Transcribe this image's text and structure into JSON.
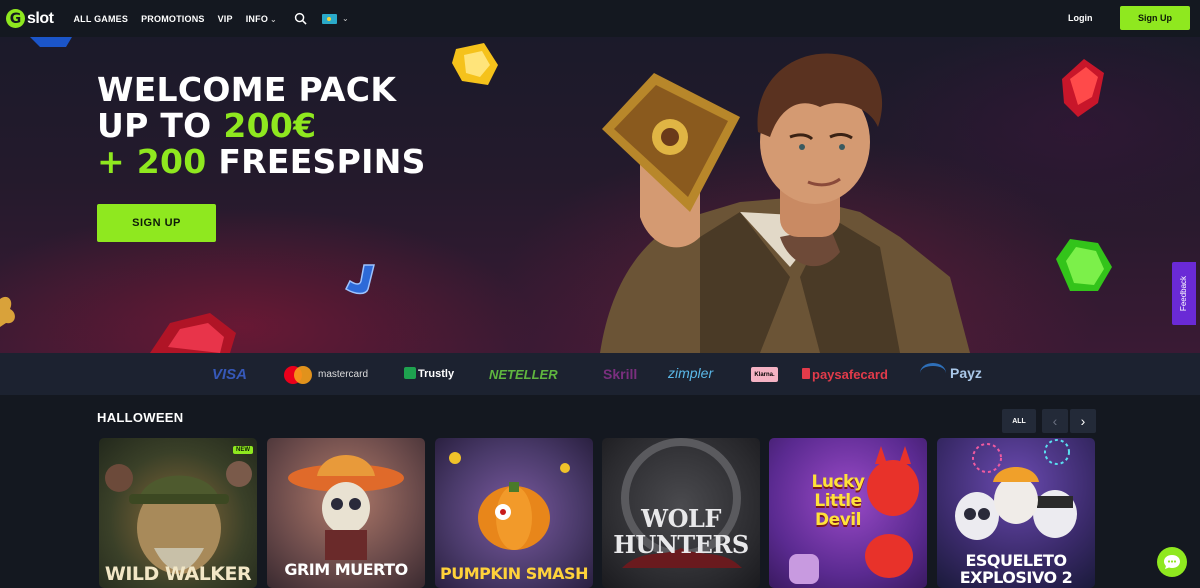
{
  "header": {
    "logo_letter": "G",
    "logo_text": "slot",
    "nav": [
      {
        "label": "ALL GAMES"
      },
      {
        "label": "PROMOTIONS"
      },
      {
        "label": "VIP"
      },
      {
        "label": "INFO"
      }
    ],
    "login_label": "Login",
    "signup_label": "Sign Up",
    "flag_icon": "kazakhstan-flag"
  },
  "hero": {
    "line1": "WELCOME PACK",
    "line2_prefix": "UP TO ",
    "line2_amount": "200€",
    "line3_plus": "+ 200",
    "line3_suffix": " FREESPINS",
    "cta_label": "SIGN UP",
    "feedback_label": "Feedback"
  },
  "payments": {
    "visa": "VISA",
    "mastercard": "mastercard",
    "trustly": "Trustly",
    "neteller": "NETELLER",
    "skrill": "Skrill",
    "zimpler": "zimpler",
    "klarna": "Klarna.",
    "paysafecard": "paysafecard",
    "payz": "Payz"
  },
  "section": {
    "title": "HALLOWEEN",
    "all_label": "ALL",
    "prev": "‹",
    "next": "›"
  },
  "games": [
    {
      "title": "WILD WALKER",
      "badge": "NEW"
    },
    {
      "title": "GRIM MUERTO"
    },
    {
      "title": "PUMPKIN SMASH"
    },
    {
      "title": "WOLF HUNTERS"
    },
    {
      "title": "Lucky Little Devil"
    },
    {
      "title": "ESQUELETO EXPLOSIVO 2"
    }
  ],
  "colors": {
    "accent": "#8fe81f",
    "background": "#141820",
    "payments_bar": "#1c2230",
    "feedback": "#6a2ad6"
  }
}
